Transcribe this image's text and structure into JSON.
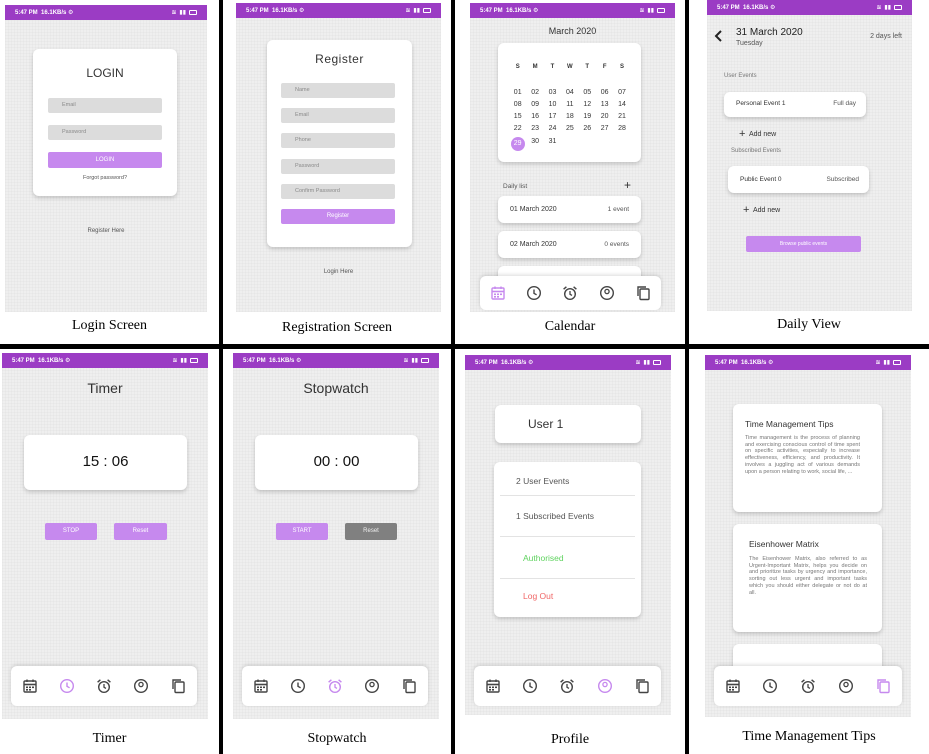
{
  "status_bar": {
    "time": "5:47 PM",
    "speed_a": "16.1KB/s",
    "speed_b": "16.1KB/s"
  },
  "captions": {
    "login": "Login Screen",
    "register": "Registration Screen",
    "calendar": "Calendar",
    "daily": "Daily View",
    "timer": "Timer",
    "stopwatch": "Stopwatch",
    "profile": "Profile",
    "tips": "Time Management Tips"
  },
  "login": {
    "title": "LOGIN",
    "email_placeholder": "Email",
    "password_placeholder": "Password",
    "login_button": "LOGIN",
    "forgot": "Forgot password?",
    "register_link": "Register Here"
  },
  "register": {
    "title": "Register",
    "name": "Name",
    "email": "Email",
    "phone": "Phone",
    "password": "Password",
    "confirm": "Confirm Password",
    "button": "Register",
    "login_link": "Login Here"
  },
  "calendar": {
    "month": "March 2020",
    "weekdays": [
      "S",
      "M",
      "T",
      "W",
      "T",
      "F",
      "S"
    ],
    "days": [
      "01",
      "02",
      "03",
      "04",
      "05",
      "06",
      "07",
      "08",
      "09",
      "10",
      "11",
      "12",
      "13",
      "14",
      "15",
      "16",
      "17",
      "18",
      "19",
      "20",
      "21",
      "22",
      "23",
      "24",
      "25",
      "26",
      "27",
      "28",
      "29",
      "30",
      "31"
    ],
    "selected_day": "29",
    "daily_list_label": "Daily list",
    "add": "+",
    "entries": [
      {
        "date": "01 March 2020",
        "count": "1 event"
      },
      {
        "date": "02 March 2020",
        "count": "0 events"
      }
    ]
  },
  "daily": {
    "back": "<",
    "date": "31 March 2020",
    "weekday": "Tuesday",
    "days_left": "2 days left",
    "user_events_label": "User Events",
    "personal_event": "Personal Event 1",
    "personal_event_time": "Full day",
    "add_new": "Add new",
    "subscribed_label": "Subscribed Events",
    "public_event": "Public Event 0",
    "public_event_status": "Subscribed",
    "browse": "Browse public events"
  },
  "timer": {
    "title": "Timer",
    "display": "15 : 06",
    "stop": "STOP",
    "reset": "Reset"
  },
  "stopwatch": {
    "title": "Stopwatch",
    "display": "00 : 00",
    "start": "START",
    "reset": "Reset"
  },
  "profile": {
    "user": "User 1",
    "user_events": "2 User Events",
    "subscribed_events": "1 Subscribed Events",
    "authorised": "Authorised",
    "logout": "Log Out"
  },
  "tips": {
    "tip1_title": "Time Management Tips",
    "tip1_body": "Time management is the process of planning and exercising conscious control of time spent on specific activities, especially to increase effectiveness, efficiency, and productivity. It involves a juggling act of various demands upon a person relating to work, social life, ...",
    "tip2_title": "Eisenhower Matrix",
    "tip2_body": "The Eisenhower Matrix, also referred to as Urgent-Important Matrix, helps you decide on and prioritize tasks by urgency and importance, sorting out less urgent and important tasks which you should either delegate or not do at all."
  },
  "colors": {
    "status_bar": "#9b3cc4",
    "accent": "#c689ee",
    "authorised": "#5fd35f",
    "logout": "#f06666"
  }
}
